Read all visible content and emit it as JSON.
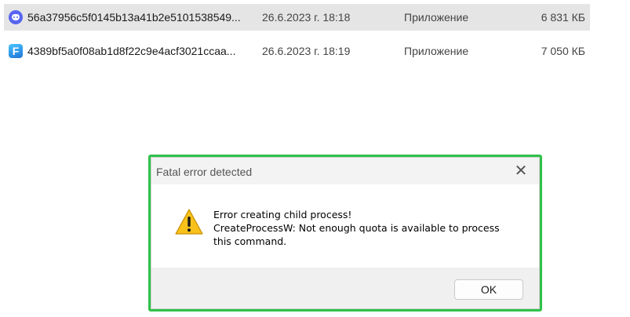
{
  "files": [
    {
      "icon": "discord-icon",
      "name": "56a37956c5f0145b13a41b2e5101538549...",
      "date": "26.6.2023 г. 18:18",
      "type": "Приложение",
      "size": "6 831 КБ",
      "selected": true
    },
    {
      "icon": "fortnite-icon",
      "icon_glyph": "F",
      "name": "4389bf5a0f08ab1d8f22c9e4acf3021ccaa...",
      "date": "26.6.2023 г. 18:19",
      "type": "Приложение",
      "size": "7 050 КБ",
      "selected": false
    }
  ],
  "dialog": {
    "title": "Fatal error detected",
    "close_glyph": "✕",
    "icon": "warning-icon",
    "message_lines": [
      "Error creating child process!",
      "CreateProcessW: Not enough quota is available to process",
      "this command."
    ],
    "ok_label": "OK"
  },
  "colors": {
    "highlight_outline": "#2fc24a",
    "selected_row": "#e5e5e5",
    "warning_yellow": "#f8c21a"
  }
}
